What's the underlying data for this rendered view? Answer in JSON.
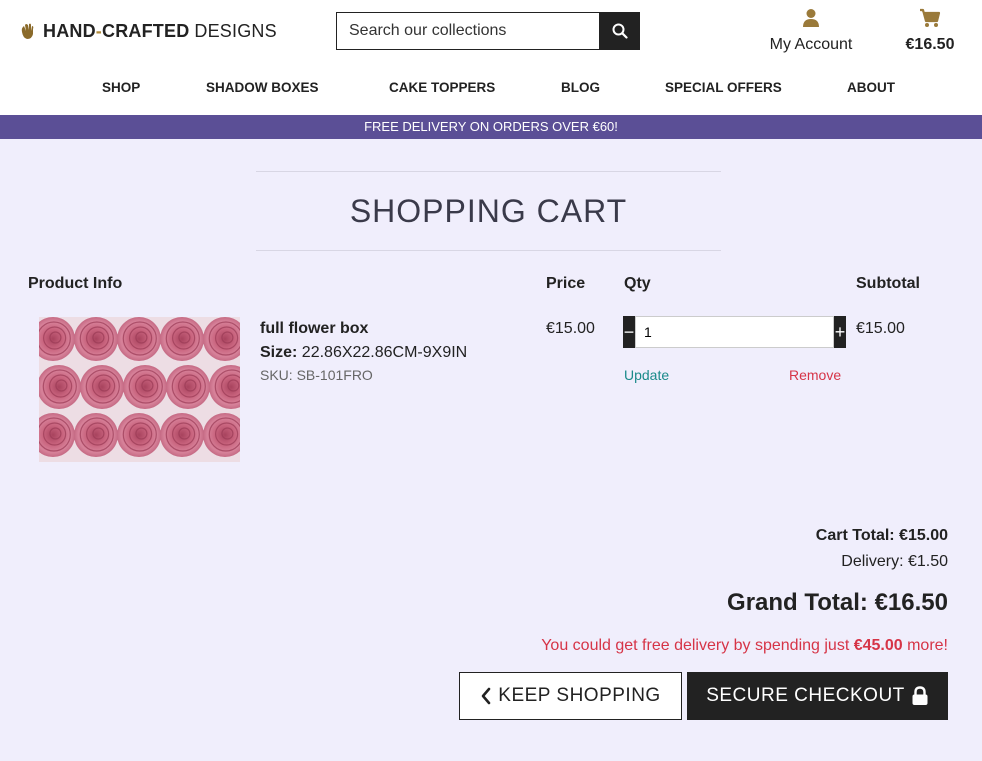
{
  "header": {
    "logo": {
      "bold": "HAND",
      "dash": "-",
      "bold2": "CRAFTED",
      "light": "DESIGNS"
    },
    "search": {
      "placeholder": "Search our collections"
    },
    "account_label": "My Account",
    "cart_total": "€16.50"
  },
  "nav": [
    "SHOP",
    "SHADOW BOXES",
    "CAKE TOPPERS",
    "BLOG",
    "SPECIAL OFFERS",
    "ABOUT"
  ],
  "banner": "FREE DELIVERY ON ORDERS OVER €60!",
  "page_title": "SHOPPING CART",
  "table_headers": {
    "product": "Product Info",
    "price": "Price",
    "qty": "Qty",
    "subtotal": "Subtotal"
  },
  "item": {
    "name": "full flower box",
    "size_label": "Size:",
    "size_value": "22.86X22.86CM-9X9IN",
    "sku": "SKU: SB-101FRO",
    "price": "€15.00",
    "qty": "1",
    "subtotal": "€15.00",
    "decrease_label": "−",
    "increase_label": "+",
    "update_label": "Update",
    "remove_label": "Remove"
  },
  "totals": {
    "cart_total": "Cart Total: €15.00",
    "delivery": "Delivery: €1.50",
    "grand_total": "Grand Total: €16.50",
    "free_msg_pre": "You could get free delivery by spending just ",
    "free_msg_amount": "€45.00",
    "free_msg_post": " more!"
  },
  "buttons": {
    "keep_shopping": "KEEP SHOPPING",
    "checkout": "SECURE CHECKOUT"
  },
  "colors": {
    "accent": "#5b4f96",
    "page_bg": "#f0eefc",
    "gold": "#9a7a3a",
    "link_teal": "#1a8a8a",
    "alert_red": "#d63447"
  },
  "icons": [
    "hand-logo-icon",
    "search-icon",
    "user-icon",
    "cart-icon",
    "chevron-left-icon",
    "lock-icon"
  ]
}
